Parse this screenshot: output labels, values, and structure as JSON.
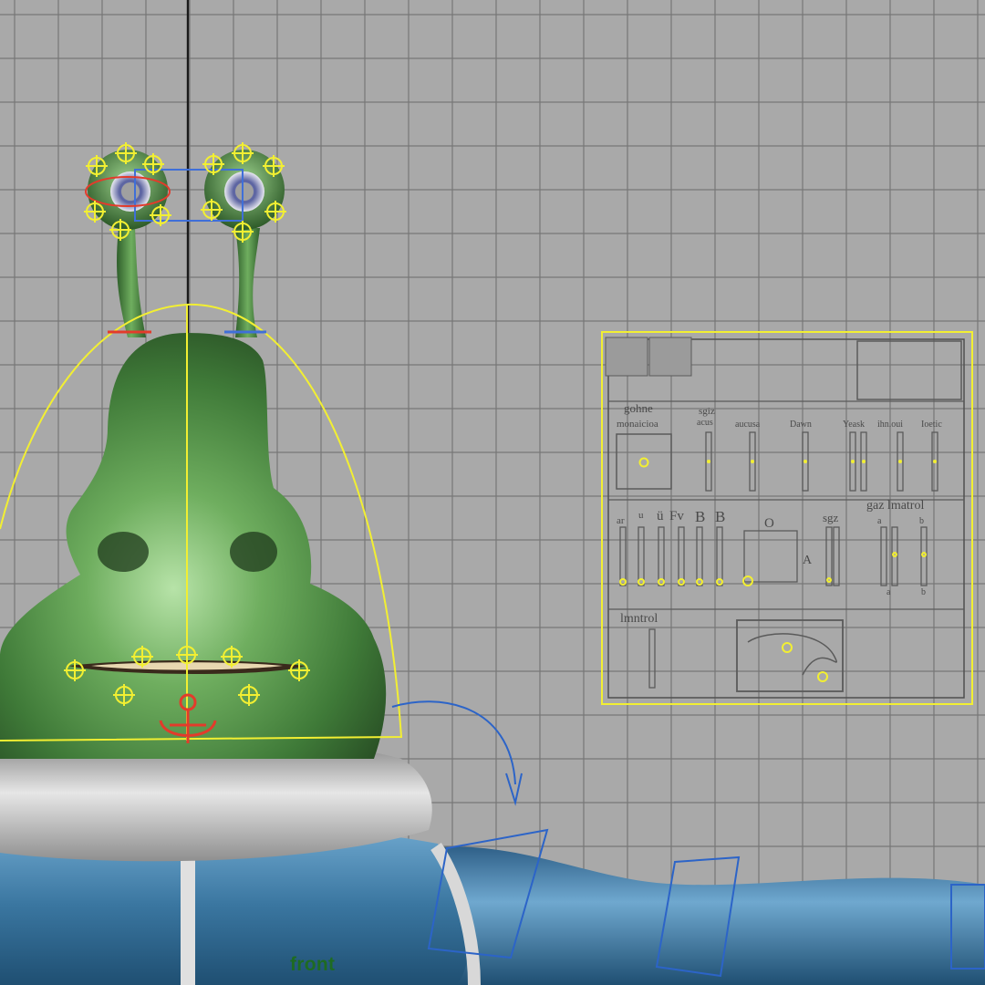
{
  "viewport": {
    "view_name": "front",
    "background_color": "#a9a9a9",
    "grid_color": "#6f6f6f",
    "axis_color": "#1a1a1a",
    "selection_color": "#f2ef32"
  },
  "character": {
    "skin_color": "#4f8c46",
    "shirt_color": "#3f7ea8",
    "collar_color": "#c9c9c9"
  },
  "control_panel": {
    "labels": {
      "outline_header": "gohne",
      "outline_sub": "monaicioa",
      "slider_header_1": "sgiz",
      "slider_sub_1": "acus",
      "slider_header_2": "aucusa",
      "slider_header_3": "Dawn",
      "slider_header_4": "Yeask",
      "slider_header_5": "ihn.oui",
      "slider_header_6": "Ioetic",
      "row2_labels": [
        "ar",
        "u",
        "ü",
        "Fv",
        "B",
        "B"
      ],
      "row2_box_label": "O",
      "row2_sgz": "sgz",
      "row2_a": "A",
      "row2_gaz_control": "gaz lmatrol",
      "row2_alpha_label": "a",
      "row2_beta_label": "b",
      "row2_alpha_sub": "a",
      "row2_beta_sub": "b",
      "row3_control": "lmntrol"
    }
  }
}
